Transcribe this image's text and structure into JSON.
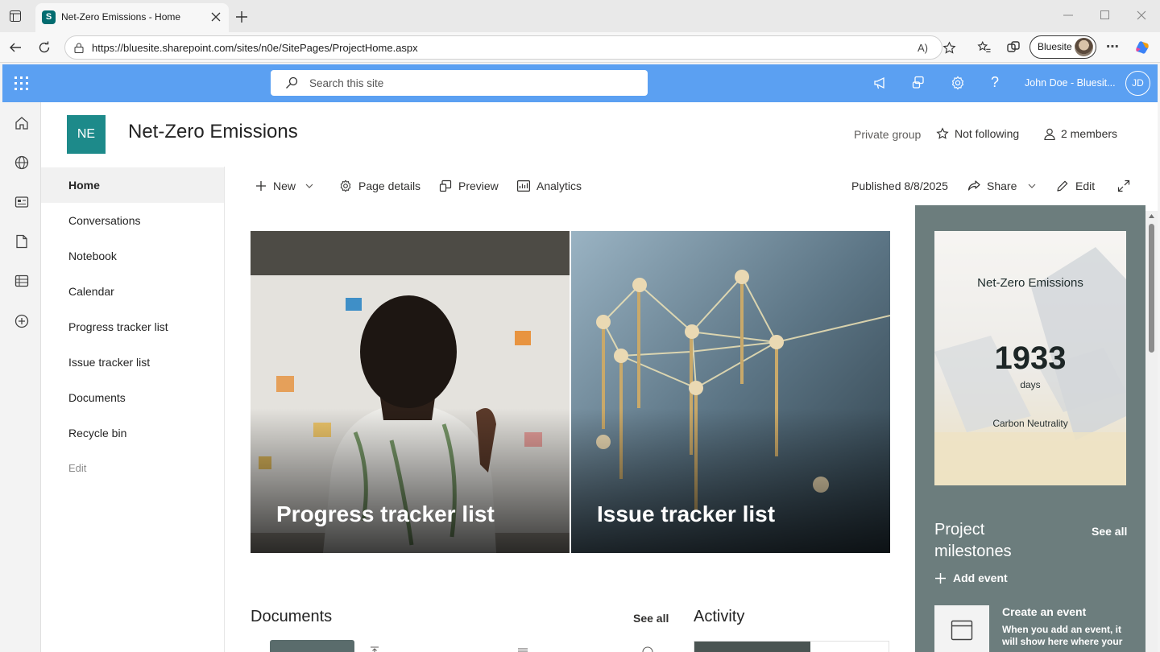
{
  "browser": {
    "tab_title": "Net-Zero Emissions - Home",
    "favicon_letter": "S",
    "url": "https://bluesite.sharepoint.com/sites/n0e/SitePages/ProjectHome.aspx",
    "profile_name": "Bluesite"
  },
  "suite": {
    "search_placeholder": "Search this site",
    "user_name": "John Doe - Bluesit...",
    "user_initials": "JD",
    "bar_color": "#5ba0f2"
  },
  "site": {
    "logo_initials": "NE",
    "title": "Net-Zero Emissions",
    "privacy": "Private group",
    "follow_label": "Not following",
    "members_label": "2 members"
  },
  "nav": {
    "items": [
      {
        "label": "Home",
        "active": true
      },
      {
        "label": "Conversations"
      },
      {
        "label": "Notebook"
      },
      {
        "label": "Calendar"
      },
      {
        "label": "Progress tracker list"
      },
      {
        "label": "Issue tracker list"
      },
      {
        "label": "Documents"
      },
      {
        "label": "Recycle bin"
      }
    ],
    "edit_label": "Edit"
  },
  "commandbar": {
    "new_label": "New",
    "page_details_label": "Page details",
    "preview_label": "Preview",
    "analytics_label": "Analytics",
    "published_label": "Published 8/8/2025",
    "share_label": "Share",
    "edit_label": "Edit"
  },
  "hero": {
    "tiles": [
      {
        "label": "Progress tracker list"
      },
      {
        "label": "Issue tracker list"
      }
    ]
  },
  "documents": {
    "title": "Documents",
    "see_all": "See all"
  },
  "activity": {
    "title": "Activity"
  },
  "countdown": {
    "title": "Net-Zero Emissions",
    "number": "1933",
    "unit": "days",
    "caption": "Carbon Neutrality"
  },
  "milestones": {
    "heading": "Project milestones",
    "see_all": "See all",
    "add_event": "Add event",
    "empty_title": "Create an event",
    "empty_desc": "When you add an event, it will show here where your"
  }
}
